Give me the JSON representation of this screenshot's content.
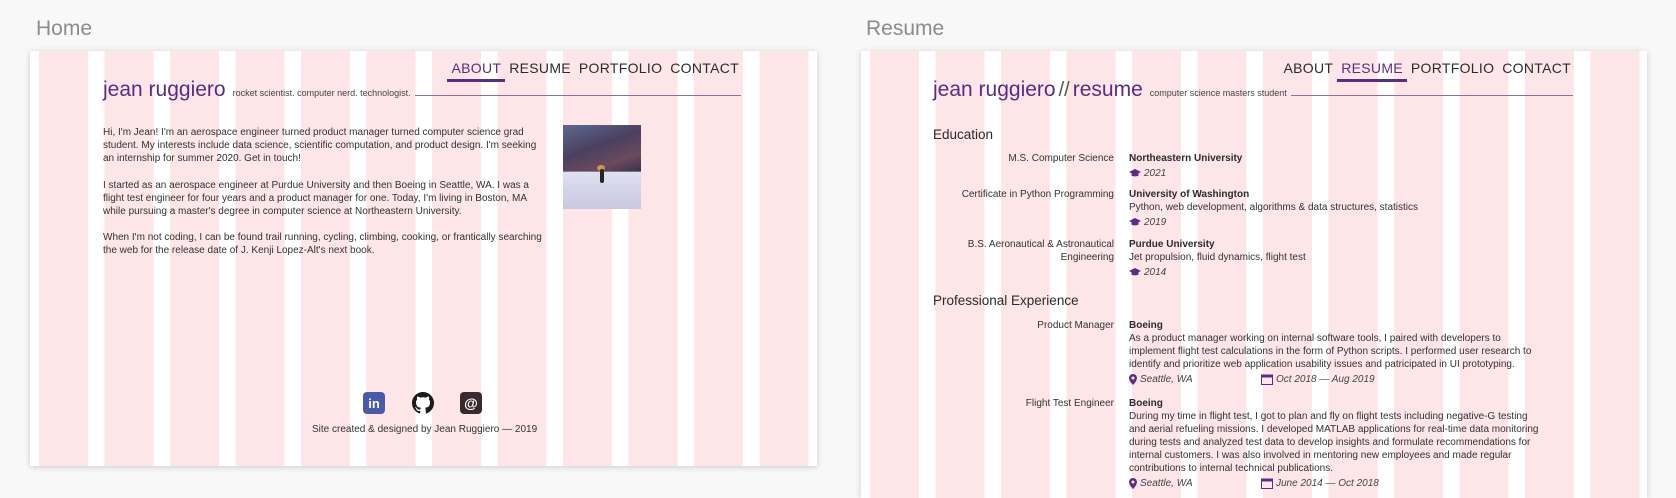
{
  "artboards": {
    "home_label": "Home",
    "resume_label": "Resume"
  },
  "nav": {
    "items": [
      "ABOUT",
      "RESUME",
      "PORTFOLIO",
      "CONTACT"
    ],
    "home_active": "ABOUT",
    "resume_active": "RESUME"
  },
  "home": {
    "name": "jean ruggiero",
    "tagline": "rocket scientist. computer nerd. technologist.",
    "paragraphs": [
      "Hi, I'm Jean! I'm an aerospace engineer turned product manager turned computer science grad student. My interests include data science, scientific computation, and product design. I'm seeking an internship for summer 2020. Get in touch!",
      "I started as an aerospace engineer at Purdue University and then Boeing in Seattle, WA. I was a flight test engineer for four years and a product manager for one. Today, I'm living in Boston, MA while pursuing a master's degree in computer science at Northeastern University.",
      "When I'm not coding, I can be found trail running, cycling, climbing, cooking, or frantically searching the web for the release date of J. Kenji Lopez-Alt's next book."
    ],
    "social": {
      "linkedin_glyph": "in",
      "email_glyph": "@"
    },
    "footer": "Site created & designed by Jean Ruggiero — 2019"
  },
  "resume": {
    "name": "jean ruggiero",
    "slash": "//",
    "title": "resume",
    "tagline": "computer science masters student",
    "education_title": "Education",
    "education": [
      {
        "label": "M.S. Computer Science",
        "org": "Northeastern University",
        "detail": "",
        "year": "2021"
      },
      {
        "label": "Certificate in Python Programming",
        "org": "University of Washington",
        "detail": "Python, web development, algorithms & data structures, statistics",
        "year": "2019"
      },
      {
        "label": "B.S. Aeronautical & Astronautical Engineering",
        "org": "Purdue University",
        "detail": "Jet propulsion, fluid dynamics, flight test",
        "year": "2014"
      }
    ],
    "experience_title": "Professional Experience",
    "experience": [
      {
        "label": "Product Manager",
        "org": "Boeing",
        "detail": "As a product manager working on internal software tools, I paired with developers to implement flight test calculations in the form of Python scripts. I performed user research to identify and prioritize web application usability issues and patricipated in UI prototyping.",
        "location": "Seattle, WA",
        "dates": "Oct 2018 — Aug 2019"
      },
      {
        "label": "Flight Test Engineer",
        "org": "Boeing",
        "detail": "During my time in flight test, I got to plan and fly on flight tests including negative-G testing and aerial refueling missions. I developed MATLAB applications for real-time data monitoring during tests and analyzed test data to develop insights and formulate recommendations for internal customers. I was also involved in mentoring new employees and made regular contributions to internal technical publications.",
        "location": "Seattle, WA",
        "dates": "June 2014 — Oct 2018"
      }
    ]
  },
  "colors": {
    "accent": "#5a2d83",
    "column_pink": "#fde5e8",
    "linkedin": "#4a5aa8",
    "github": "#1b1b1b",
    "email": "#3a2a2e"
  }
}
